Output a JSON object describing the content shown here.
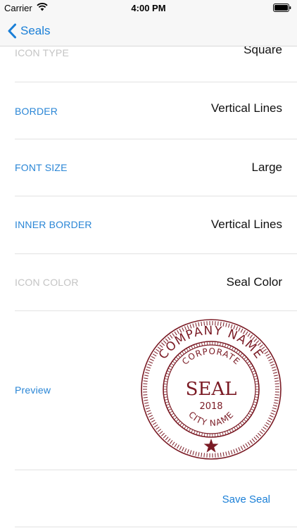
{
  "status_bar": {
    "carrier": "Carrier",
    "time": "4:00 PM"
  },
  "nav": {
    "back_label": "Seals"
  },
  "rows": [
    {
      "label": "ICON TYPE",
      "value": "Square",
      "label_style": "gray"
    },
    {
      "label": "BORDER",
      "value": "Vertical Lines",
      "label_style": "blue"
    },
    {
      "label": "FONT SIZE",
      "value": "Large",
      "label_style": "blue"
    },
    {
      "label": "INNER BORDER",
      "value": "Vertical Lines",
      "label_style": "blue"
    },
    {
      "label": "ICON COLOR",
      "value": "Seal Color",
      "label_style": "gray"
    }
  ],
  "preview": {
    "label": "Preview",
    "seal": {
      "top_arc": "COMPANY NAME",
      "inner_top_arc": "CORPORATE",
      "center": "SEAL",
      "year": "2018",
      "inner_bottom_arc": "CITY NAME",
      "color": "#7a1a24"
    }
  },
  "save_label": "Save Seal",
  "colors": {
    "accent": "#1a7fd7",
    "seal": "#7a1a24"
  }
}
